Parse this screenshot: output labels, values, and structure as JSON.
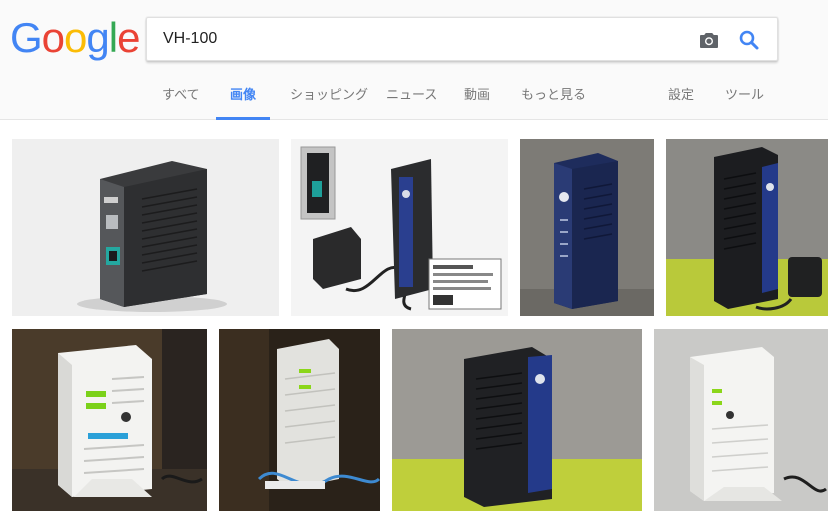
{
  "logo": {
    "letters": [
      {
        "ch": "G",
        "color": "#4285f4"
      },
      {
        "ch": "o",
        "color": "#ea4335"
      },
      {
        "ch": "o",
        "color": "#fbbc05"
      },
      {
        "ch": "g",
        "color": "#4285f4"
      },
      {
        "ch": "l",
        "color": "#34a853"
      },
      {
        "ch": "e",
        "color": "#ea4335"
      }
    ]
  },
  "search": {
    "query": "VH-100",
    "camera_icon": "camera-icon",
    "search_icon": "search-icon"
  },
  "tabs": {
    "all": "すべて",
    "images": "画像",
    "shopping": "ショッピング",
    "news": "ニュース",
    "videos": "動画",
    "more": "もっと見る",
    "settings": "設定",
    "tools": "ツール"
  },
  "colors": {
    "accent": "#4285f4",
    "tab_text": "#777777",
    "header_bg": "#fafafa"
  },
  "results": {
    "count": 8,
    "items": [
      {
        "name": "router-dark-gray-white-background"
      },
      {
        "name": "router-black-with-adapter-and-label"
      },
      {
        "name": "router-navy-ntt-gray-background"
      },
      {
        "name": "router-black-ntt-green-table"
      },
      {
        "name": "router-white-ntt-dark-background"
      },
      {
        "name": "router-white-ntt-closeup-dark"
      },
      {
        "name": "router-black-ntt-green-floor"
      },
      {
        "name": "router-white-ntt-gray-background"
      }
    ]
  }
}
